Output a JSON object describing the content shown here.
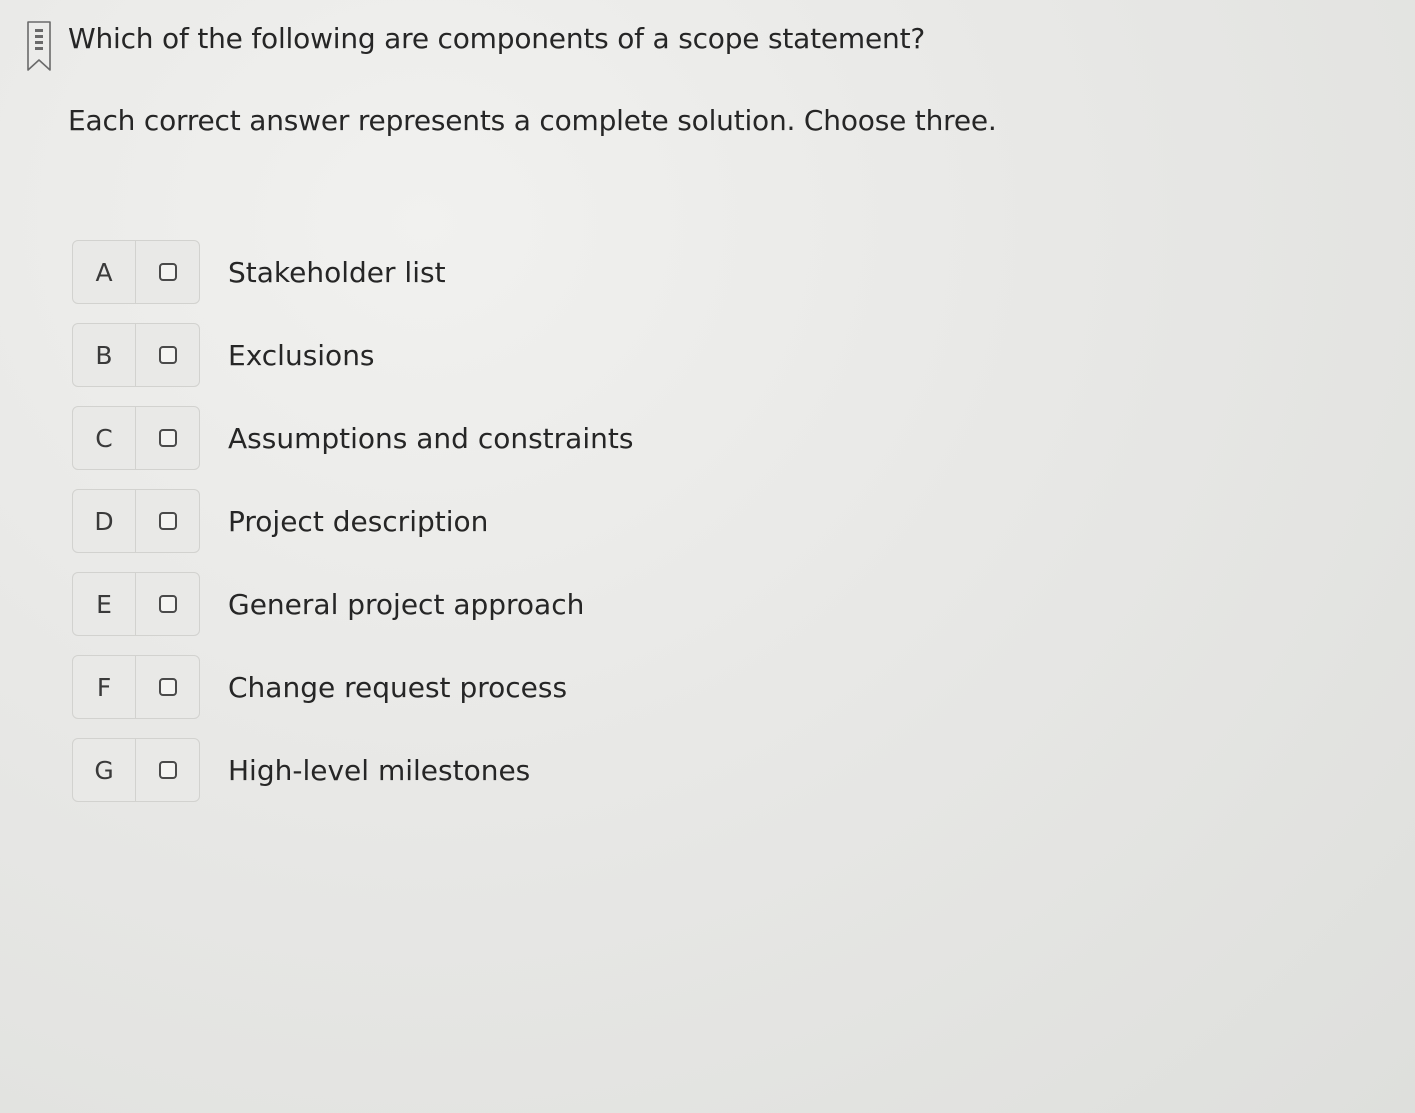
{
  "question": {
    "bookmark_icon": "bookmark-flag-icon",
    "text": "Which of the following are components of a scope statement?",
    "instruction": "Each correct answer represents a complete solution. Choose three."
  },
  "options": [
    {
      "letter": "A",
      "text": "Stakeholder list",
      "checked": false
    },
    {
      "letter": "B",
      "text": "Exclusions",
      "checked": false
    },
    {
      "letter": "C",
      "text": "Assumptions and constraints",
      "checked": false
    },
    {
      "letter": "D",
      "text": "Project description",
      "checked": false
    },
    {
      "letter": "E",
      "text": "General project approach",
      "checked": false
    },
    {
      "letter": "F",
      "text": "Change request process",
      "checked": false
    },
    {
      "letter": "G",
      "text": "High-level milestones",
      "checked": false
    }
  ],
  "colors": {
    "background": "#e8e8e6",
    "text": "#262626",
    "option_border": "#d2d2cf"
  }
}
